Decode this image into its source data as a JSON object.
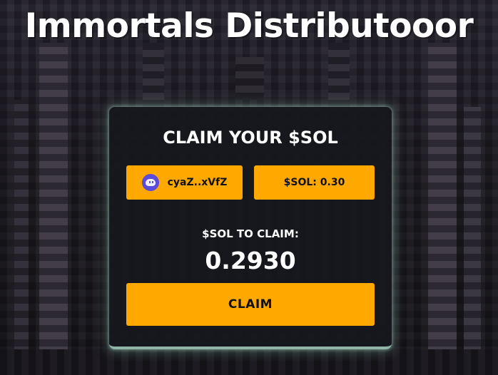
{
  "page": {
    "title": "Immortals Distributooor"
  },
  "card": {
    "title": "CLAIM YOUR $SOL",
    "wallet": {
      "address": "cyaZ..xVfZ",
      "icon": "phantom-wallet-icon",
      "icon_color": "#5b4bd9"
    },
    "balance": {
      "label": "$SOL: 0.30"
    },
    "claim_label": "$SOL TO CLAIM:",
    "claim_amount": "0.2930",
    "claim_button": "CLAIM"
  },
  "colors": {
    "accent": "#ffa800",
    "card_background": "#16181d",
    "card_glow": "#8fb5a6",
    "text": "#ffffff"
  }
}
